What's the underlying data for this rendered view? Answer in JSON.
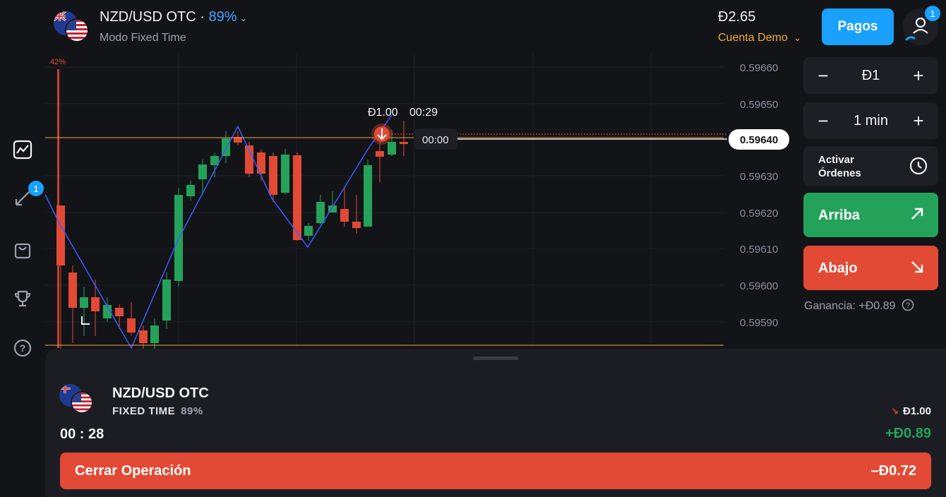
{
  "header": {
    "asset_name": "NZD/USD OTC",
    "asset_sep": " · ",
    "asset_payout": "89%",
    "asset_mode": "Modo Fixed Time",
    "balance": "Đ2.65",
    "account": "Cuenta Demo",
    "payments_label": "Pagos",
    "profile_badge": "1"
  },
  "rail": {
    "trades_badge": "1"
  },
  "chart": {
    "top_pct_label": "42%",
    "price_axis": [
      "0.59660",
      "0.59650",
      "0.59640",
      "0.59630",
      "0.59620",
      "0.59610",
      "0.59600",
      "0.59590"
    ],
    "current_price": "0.59640",
    "trade_amount": "Đ1.00",
    "trade_timer": "00:29",
    "expiry_label": "00:00",
    "colors": {
      "up": "#25a25a",
      "down": "#e24a35",
      "zigzag": "#3b5bff",
      "level": "#f2a93b"
    }
  },
  "trade_panel": {
    "amount": "Đ1",
    "duration": "1 min",
    "orders_line1": "Activar",
    "orders_line2": "Órdenes",
    "up_label": "Arriba",
    "down_label": "Abajo",
    "payout_text": "Ganancia: +Đ0.89"
  },
  "open_trade": {
    "asset_name": "NZD/USD OTC",
    "mode": "FIXED TIME",
    "payout": "89%",
    "timer": "00 : 28",
    "amount": "Đ1.00",
    "profit": "+Đ0.89",
    "close_label": "Cerrar Operación",
    "close_value": "–Đ0.72"
  }
}
